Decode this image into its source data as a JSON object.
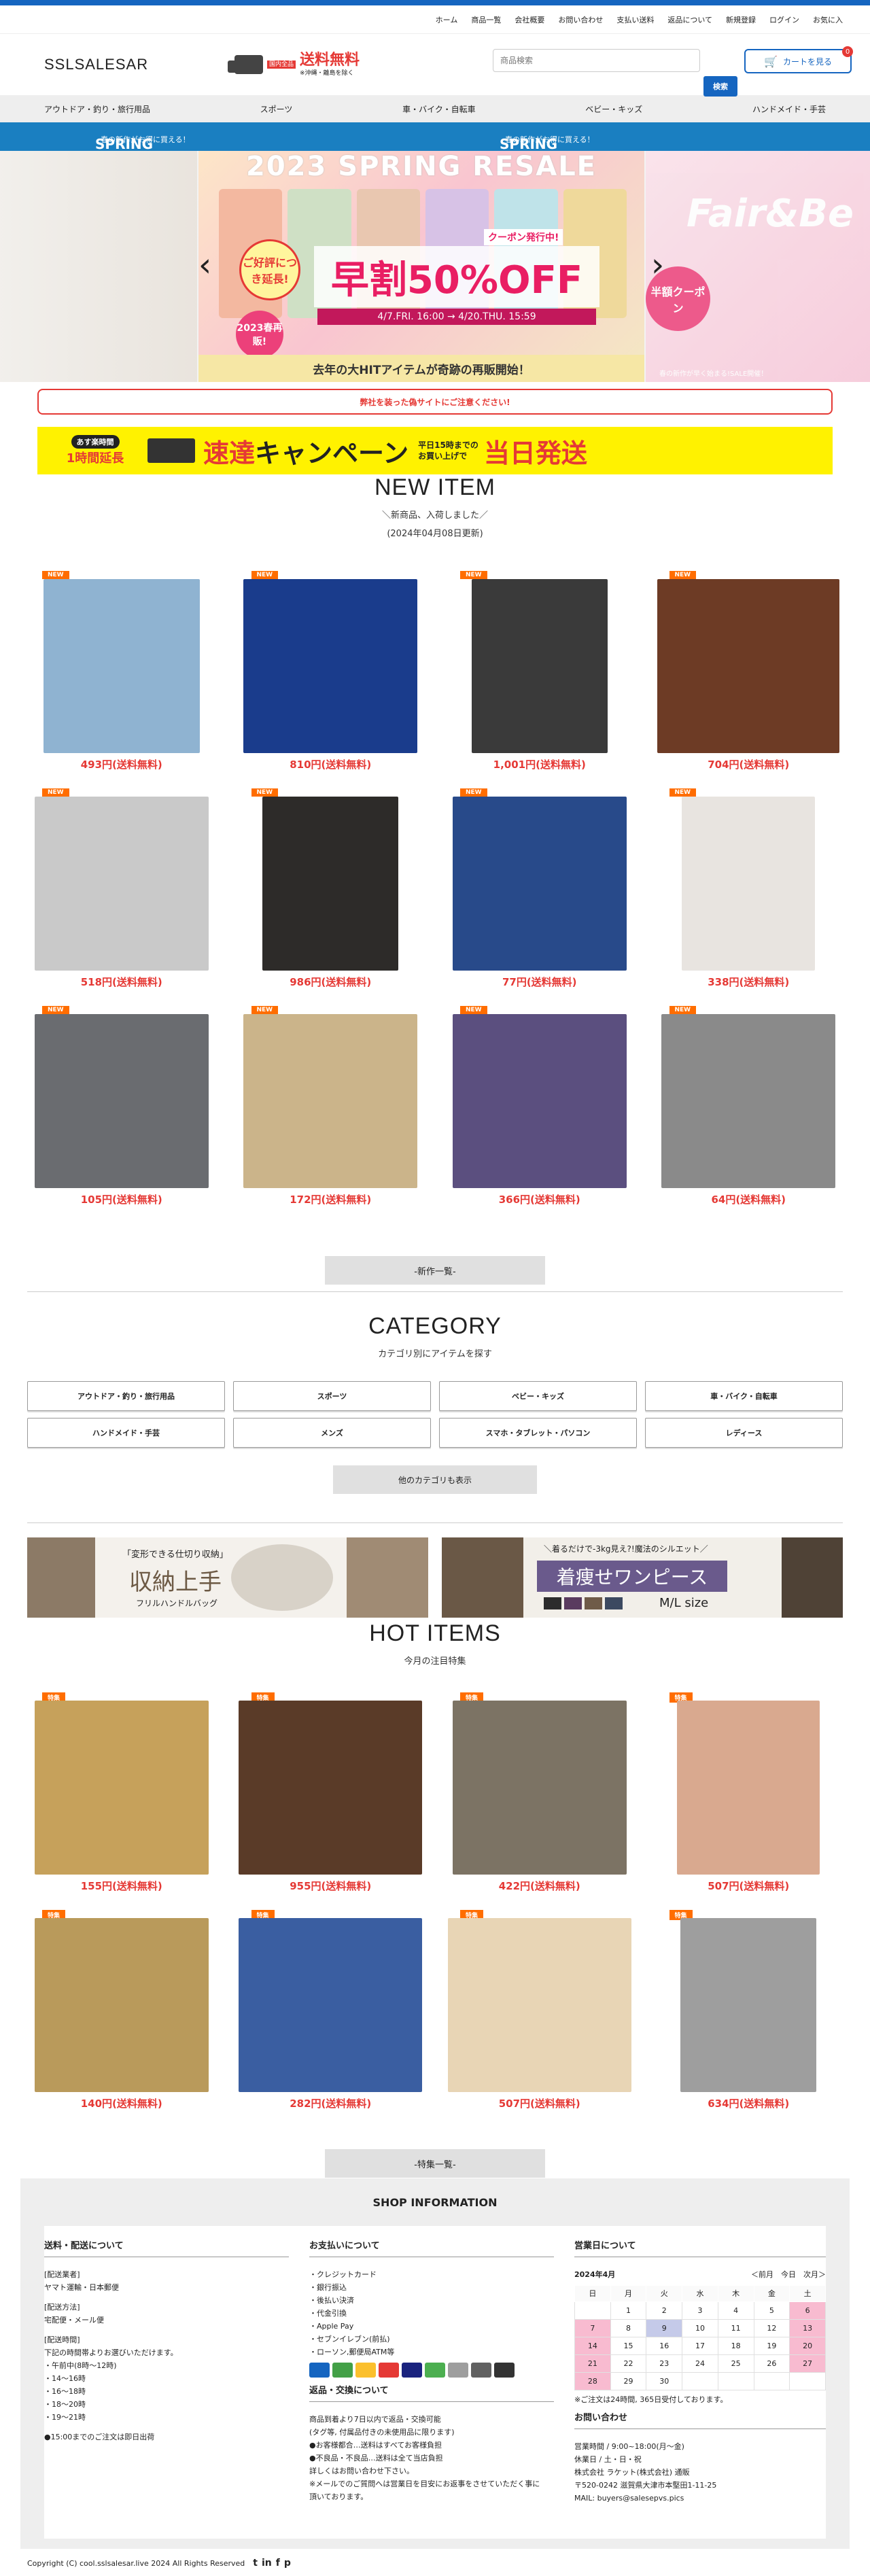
{
  "toplinks": [
    "ホーム",
    "商品一覧",
    "会社概要",
    "お問い合わせ",
    "支払い送料",
    "返品について",
    "新規登録",
    "ログイン",
    "お気に入"
  ],
  "header": {
    "logo": "SSLSALESAR",
    "badge_small": "国内全品",
    "badge_main": "送料無料",
    "badge_sub": "※沖縄・離島を除く",
    "search_placeholder": "商品検索",
    "search_button": "検索",
    "cart_label": "カートを見る",
    "cart_count": "0"
  },
  "catnav": [
    "アウトドア・釣り・旅行用品",
    "スポーツ",
    "車・バイク・自転車",
    "ベビー・キッズ",
    "ハンドメイド・手芸"
  ],
  "saleband": {
    "left": "SPRING SALE",
    "left_sub": "春の新作がお得に買える！",
    "right": "SPRING SALE",
    "right_sub": "春の新作がお得に買える！"
  },
  "banner": {
    "title": "2023 SPRING RESALE",
    "pill": "ご好評につき延長!",
    "coupon": "クーポン発行中!",
    "big": "早割50%OFF",
    "dates": "4/7.FRI. 16:00 → 4/20.THU. 15:59",
    "pink": "2023春再販!",
    "foot": "去年の大HITアイテムが奇跡の再販開始！",
    "prev": "‹",
    "next": "›",
    "right_title": "Fair&Be",
    "right_coupon": "半額クーポン",
    "right_foot": "春の新作が早く始まる!SALE開催！"
  },
  "warning": "弊社を装った偽サイトにご注意ください!",
  "campaign": {
    "a1": "あす楽時間",
    "a2": "1時間延長",
    "b1": "速達",
    "b2": "キャンペーン",
    "c1": "平日15時までの",
    "c2": "お買い上げで",
    "d": "当日発送"
  },
  "newitem": {
    "title": "NEW ITEM",
    "sub": "＼新商品、入荷しました／",
    "date": "(2024年04月08日更新)",
    "tag": "NEW",
    "more": "-新作一覧-",
    "items": [
      {
        "price": "493円(送料無料)",
        "color": "#8fb3d1"
      },
      {
        "price": "810円(送料無料)",
        "color": "#1a3c8c"
      },
      {
        "price": "1,001円(送料無料)",
        "color": "#3a3a3a"
      },
      {
        "price": "704円(送料無料)",
        "color": "#6d3b25"
      },
      {
        "price": "518円(送料無料)",
        "color": "#c9c9c9"
      },
      {
        "price": "986円(送料無料)",
        "color": "#2d2b29"
      },
      {
        "price": "77円(送料無料)",
        "color": "#284a8a"
      },
      {
        "price": "338円(送料無料)",
        "color": "#e8e4e0"
      },
      {
        "price": "105円(送料無料)",
        "color": "#6a6c70"
      },
      {
        "price": "172円(送料無料)",
        "color": "#cbb48a"
      },
      {
        "price": "366円(送料無料)",
        "color": "#5b4f7f"
      },
      {
        "price": "64円(送料無料)",
        "color": "#8a8a8a"
      }
    ]
  },
  "category": {
    "title": "CATEGORY",
    "sub": "カテゴリ別にアイテムを探す",
    "items": [
      "アウトドア・釣り・旅行用品",
      "スポーツ",
      "ベビー・キッズ",
      "車・バイク・自転車",
      "ハンドメイド・手芸",
      "メンズ",
      "スマホ・タブレット・パソコン",
      "レディース"
    ],
    "more": "他のカテゴリも表示"
  },
  "ads": {
    "left_title": "収納上手",
    "left_catch": "「変形できる仕切り収納」",
    "left_sub": "フリルハンドルバッグ",
    "right_title": "着痩せワンピース",
    "right_catch": "＼着るだけで-3kg見え?!魔法のシルエット／",
    "right_size": "M/L size"
  },
  "hot": {
    "title": "HOT ITEMS",
    "sub": "今月の注目特集",
    "tag": "特集",
    "more": "-特集一覧-",
    "items": [
      {
        "price": "155円(送料無料)",
        "color": "#c6a15b"
      },
      {
        "price": "955円(送料無料)",
        "color": "#5a3b28"
      },
      {
        "price": "422円(送料無料)",
        "color": "#7c7364"
      },
      {
        "price": "507円(送料無料)",
        "color": "#d9a98f"
      },
      {
        "price": "140円(送料無料)",
        "color": "#b99a5b"
      },
      {
        "price": "282円(送料無料)",
        "color": "#3a5ea1"
      },
      {
        "price": "507円(送料無料)",
        "color": "#e8d5b5"
      },
      {
        "price": "634円(送料無料)",
        "color": "#9e9e9e"
      }
    ]
  },
  "footer": {
    "title": "SHOP INFORMATION",
    "ship": {
      "h": "送料・配送について",
      "lines": [
        "[配送業者]",
        "ヤマト運輸・日本郵便",
        "",
        "[配送方法]",
        "宅配便・メール便",
        "",
        "[配送時間]",
        "下記の時間帯よりお選びいただけます。",
        "・午前中(8時〜12時)",
        "・14〜16時",
        "・16〜18時",
        "・18〜20時",
        "・19〜21時",
        "",
        "●15:00までのご注文は即日出荷"
      ]
    },
    "pay": {
      "h": "お支払いについて",
      "lines": [
        "・クレジットカード",
        "・銀行振込",
        "・後払い決済",
        "・代金引換",
        "・Apple Pay",
        "・セブンイレブン(前払)",
        "・ローソン,郵便局ATM等"
      ],
      "h2": "返品・交換について",
      "lines2": [
        "商品到着より7日以内で返品・交換可能",
        "(タグ等, 付属品付きの未使用品に限ります)",
        "●お客様都合…送料はすべてお客様負担",
        "●不良品・不良品…送料は全て当店負担",
        "詳しくはお問い合わせ下さい。",
        "※メールでのご質問へは営業日を目安にお返事をさせていただく事に",
        "頂いております。"
      ]
    },
    "biz": {
      "h": "営業日について",
      "month": "2024年4月",
      "nav": "＜前月　今日　次月＞",
      "days": [
        "日",
        "月",
        "火",
        "水",
        "木",
        "金",
        "土"
      ],
      "weeks": [
        [
          "",
          "1",
          "2",
          "3",
          "4",
          "5",
          "6"
        ],
        [
          "7",
          "8",
          "9",
          "10",
          "11",
          "12",
          "13"
        ],
        [
          "14",
          "15",
          "16",
          "17",
          "18",
          "19",
          "20"
        ],
        [
          "21",
          "22",
          "23",
          "24",
          "25",
          "26",
          "27"
        ],
        [
          "28",
          "29",
          "30",
          "",
          "",
          "",
          ""
        ]
      ],
      "note": "※ご注文は24時間, 365日受付しております。",
      "h2": "お問い合わせ",
      "lines": [
        "営業時間 / 9:00~18:00(月〜金)",
        "休業日 / 土・日・祝",
        "株式会社 ラケット(株式会社) 通販",
        "〒520-0242 滋賀県大津市本堅田1-11-25",
        "MAIL: buyers@salesepvs.pics"
      ]
    }
  },
  "copyright": "Copyright (C) cool.sslsalesar.live 2024 All Rights Reserved",
  "social": [
    "t",
    "in",
    "f",
    "p"
  ]
}
